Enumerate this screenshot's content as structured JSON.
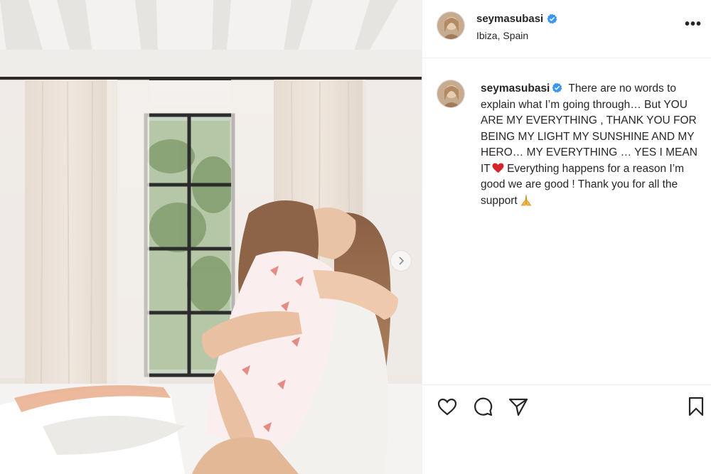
{
  "post": {
    "username": "seymasubasi",
    "location": "Ibiza, Spain",
    "more_label": "•••",
    "caption_username": "seymasubasi",
    "caption_part1": " There are no words to explain what I’m going through… But YOU ARE MY EVERYTHING , THANK YOU FOR BEING MY LIGHT MY SUNSHINE AND MY HERO… MY EVERYTHING … YES I MEAN IT",
    "caption_part2": " Everything happens for a reason I’m good we are good ! Thank you for all the support",
    "verified_color": "#3897f0",
    "heart_color": "#d8222b"
  },
  "icons": {
    "verified": "verified-badge-icon",
    "heart_emoji": "red-heart-emoji-icon",
    "pray_emoji": "folded-hands-emoji-icon",
    "next": "chevron-right-icon",
    "like": "heart-outline-icon",
    "comment": "speech-bubble-icon",
    "share": "paper-plane-icon",
    "save": "bookmark-icon"
  }
}
